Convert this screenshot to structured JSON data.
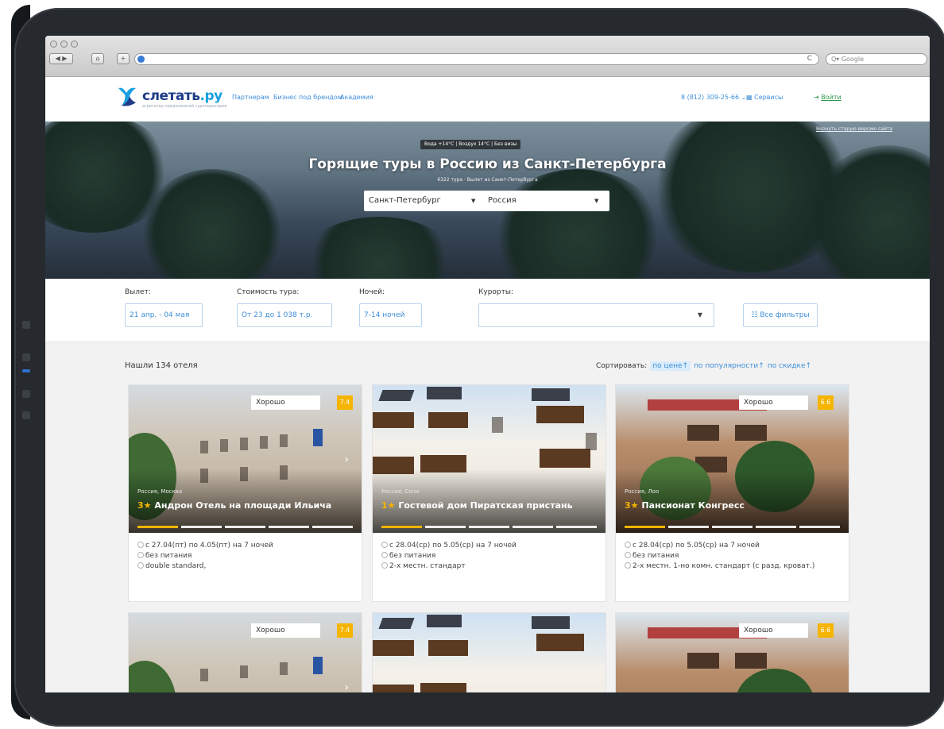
{
  "browser": {
    "search_placeholder": "Q▾ Google",
    "reload_icon": "C"
  },
  "header": {
    "logo": {
      "main": "слетать",
      "suffix": ".ру",
      "tagline": "агрегатор предложений туроператоров"
    },
    "links": [
      "Партнерам",
      "Бизнес под брендом",
      "Академия"
    ],
    "phone": "8 (812) 309-25-66 ⌄",
    "services": "Сервисы",
    "login": "Войти"
  },
  "hero": {
    "old_version_link": "Вернуть старую версию сайта",
    "badge": "Вода +14°C | Воздух 14°C | Без визы",
    "title": "Горящие туры в Россию из Санкт-Петербурга",
    "subtitle": "6322 тура · Вылет из Санкт-Петербурга",
    "city_select": "Санкт-Петербург",
    "country_select": "Россия"
  },
  "filters": {
    "departure_label": "Вылет:",
    "departure_value": "21 апр. - 04 мая",
    "price_label": "Стоимость тура:",
    "price_value": "От 23 до 1 038 т.р.",
    "nights_label": "Ночей:",
    "nights_value": "7-14 ночей",
    "resorts_label": "Курорты:",
    "resorts_value": "",
    "all_filters": "Все фильтры"
  },
  "results": {
    "found": "Нашли 134 отеля",
    "sort_label": "Сортировать:",
    "sort_options": [
      "по цене↑",
      "по популярности↑",
      "по скидке↑"
    ]
  },
  "cards": [
    {
      "rating_label": "Хорошо",
      "rating_score": "7.4",
      "location": "Россия, Москва",
      "stars": "3★",
      "name": "Андрон Отель на площади Ильича",
      "dates": "с 27.04(пт) по 4.05(пт) на 7 ночей",
      "meal": "без питания",
      "room": "double standard,"
    },
    {
      "rating_label": "",
      "rating_score": "",
      "location": "Россия, Сочи",
      "stars": "1★",
      "name": "Гостевой дом Пиратская пристань",
      "dates": "с 28.04(ср) по 5.05(ср) на 7 ночей",
      "meal": "без питания",
      "room": "2-х местн. стандарт"
    },
    {
      "rating_label": "Хорошо",
      "rating_score": "6.6",
      "location": "Россия, Лоо",
      "stars": "3★",
      "name": "Пансионат Конгресс",
      "dates": "с 28.04(ср) по 5.05(ср) на 7 ночей",
      "meal": "без питания",
      "room": "2-х местн. 1-но комн. стандарт (с разд. кроват.)"
    },
    {
      "rating_label": "Хорошо",
      "rating_score": "7.4"
    },
    {
      "rating_label": "",
      "rating_score": ""
    },
    {
      "rating_label": "Хорошо",
      "rating_score": "6.6"
    }
  ],
  "colors": {
    "accent": "#3f8ed8",
    "rating": "#f5b400",
    "login": "#2e9b4e",
    "logo": "#1f3c88"
  }
}
